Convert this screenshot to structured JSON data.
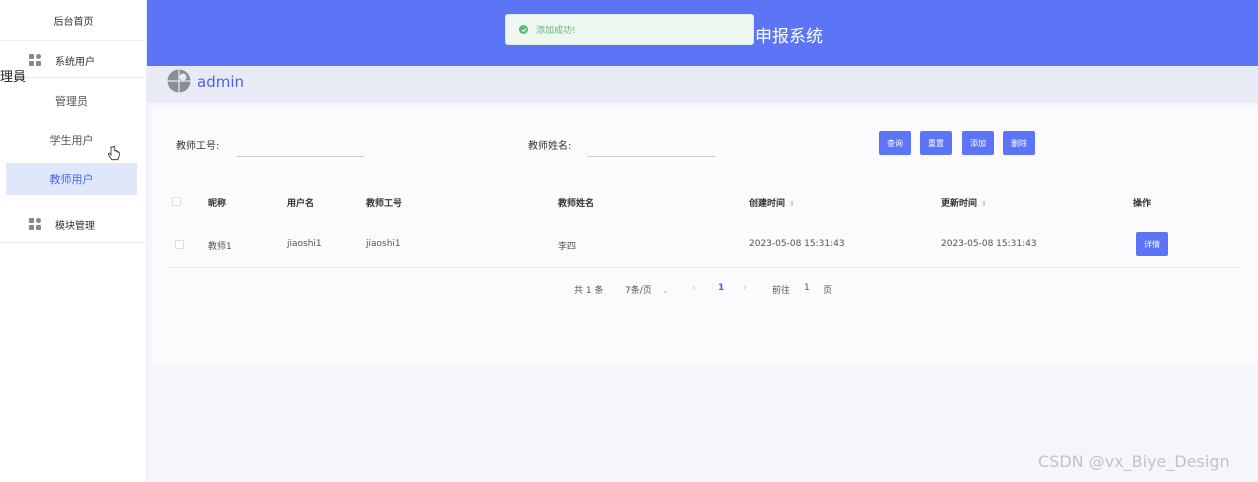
{
  "sidebar": {
    "home_label": "后台首页",
    "group_users": "系统用户",
    "sub_items": [
      "管理员",
      "学生用户",
      "教师用户"
    ],
    "group_modules": "模块管理",
    "fragment": "理員"
  },
  "header": {
    "title": "申报系统",
    "toast": "添加成功!"
  },
  "userbar": {
    "username": "admin"
  },
  "search": {
    "teacher_id_label": "教师工号:",
    "teacher_id_value": "",
    "teacher_name_label": "教师姓名:",
    "teacher_name_value": ""
  },
  "buttons": {
    "query": "查询",
    "reset": "重置",
    "add": "添加",
    "delete": "删除"
  },
  "table": {
    "headers": [
      "昵称",
      "用户名",
      "教师工号",
      "教师姓名",
      "创建时间",
      "更新时间",
      "操作"
    ],
    "rows": [
      {
        "nickname": "教师1",
        "username": "jiaoshi1",
        "teacher_id": "jiaoshi1",
        "teacher_name": "李四",
        "created": "2023-05-08 15:31:43",
        "updated": "2023-05-08 15:31:43",
        "action": "详情"
      }
    ]
  },
  "pagination": {
    "total": "共 1 条",
    "page_size": "7条/页",
    "current_page": "1",
    "goto_label": "前往",
    "goto_value": "1",
    "page_unit": "页"
  },
  "watermark": "CSDN @vx_Biye_Design",
  "colors": {
    "primary": "#5b75f6",
    "active_bg": "#e1e7fb",
    "success": "#58b874"
  }
}
